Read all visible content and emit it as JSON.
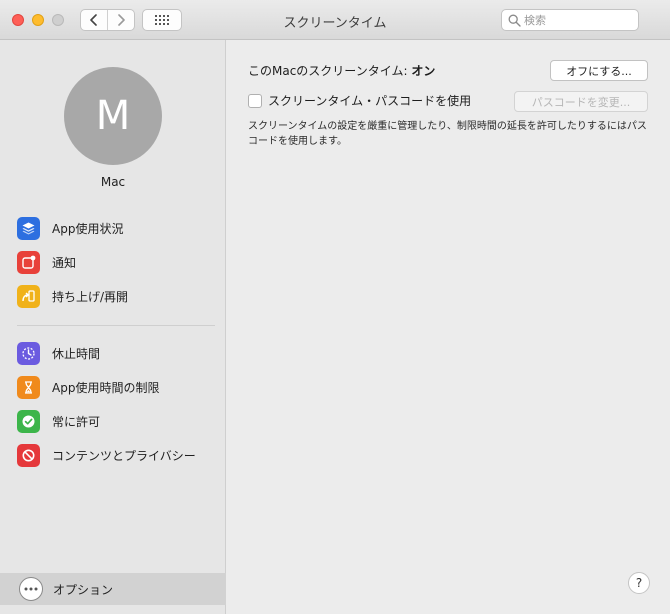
{
  "window": {
    "title": "スクリーンタイム"
  },
  "toolbar": {
    "back_icon": "chevron-left-icon",
    "forward_icon": "chevron-right-icon",
    "grid_icon": "grid-icon",
    "search": {
      "placeholder": "検索",
      "value": ""
    }
  },
  "sidebar": {
    "user": {
      "initial": "M",
      "name": "Mac"
    },
    "items": [
      {
        "label": "App使用状況",
        "icon": "layers-icon",
        "color": "#2d6fe0"
      },
      {
        "label": "通知",
        "icon": "notification-icon",
        "color": "#e8413a"
      },
      {
        "label": "持ち上げ/再開",
        "icon": "pickup-icon",
        "color": "#f0b21a"
      },
      {
        "label": "休止時間",
        "icon": "downtime-icon",
        "color": "#6b5be0"
      },
      {
        "label": "App使用時間の制限",
        "icon": "hourglass-icon",
        "color": "#f08a1c"
      },
      {
        "label": "常に許可",
        "icon": "checkmark-badge-icon",
        "color": "#3cb54a"
      },
      {
        "label": "コンテンツとプライバシー",
        "icon": "restrict-icon",
        "color": "#e5383b"
      }
    ],
    "options_label": "オプション"
  },
  "main": {
    "status_prefix": "このMacのスクリーンタイム: ",
    "status_value": "オン",
    "turn_off_button": "オフにする...",
    "passcode_checkbox_label": "スクリーンタイム・パスコードを使用",
    "passcode_checked": false,
    "change_passcode_button": "パスコードを変更...",
    "description": "スクリーンタイムの設定を厳重に管理したり、制限時間の延長を許可したりするにはパスコードを使用します。",
    "help_label": "?"
  }
}
